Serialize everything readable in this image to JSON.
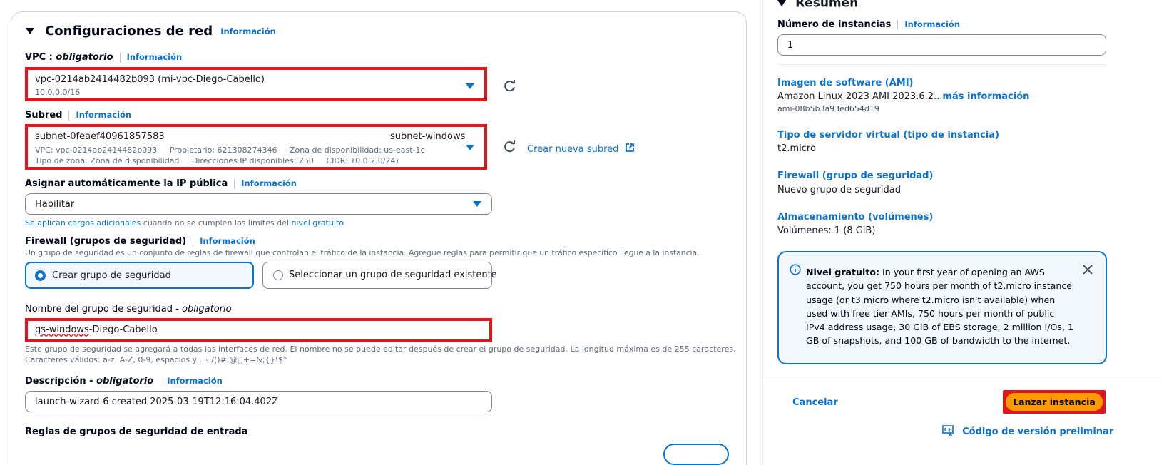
{
  "left": {
    "section_title": "Configuraciones de red",
    "section_info": "Información",
    "vpc": {
      "label": "VPC : ",
      "label_req": "obligatorio",
      "info": "Información",
      "value": "vpc-0214ab2414482b093 (mi-vpc-Diego-Cabello)",
      "cidr": "10.0.0.0/16"
    },
    "subnet": {
      "label": "Subred",
      "info": "Información",
      "id": "subnet-0feaef40961857583",
      "name": "subnet-windows",
      "line2": "VPC: vpc-0214ab2414482b093     Propietario: 621308274346     Zona de disponibilidad: us-east-1c",
      "line3": "Tipo de zona: Zona de disponibilidad     Direcciones IP disponibles: 250     CIDR: 10.0.2.0/24)",
      "create_link": "Crear nueva subred"
    },
    "public_ip": {
      "label": "Asignar automáticamente la IP pública",
      "info": "Información",
      "value": "Habilitar",
      "note_link": "Se aplican cargos adicionales",
      "note_mid": " cuando no se cumplen los límites del ",
      "note_link2": "nivel gratuito"
    },
    "firewall": {
      "label": "Firewall (grupos de seguridad)",
      "info": "Información",
      "desc": "Un grupo de seguridad es un conjunto de reglas de firewall que controlan el tráfico de la instancia. Agregue reglas para permitir que un tráfico específico llegue a la instancia.",
      "option_create": "Crear grupo de seguridad",
      "option_existing": "Seleccionar un grupo de seguridad existente"
    },
    "sg_name": {
      "label": "Nombre del grupo de seguridad - ",
      "label_req": "obligatorio",
      "value_underlined": "gs-windows",
      "value_rest": "-Diego-Cabello",
      "help1": "Este grupo de seguridad se agregará a todas las interfaces de red. El nombre no se puede editar después de crear el grupo de seguridad. La longitud máxima es de 255 caracteres.",
      "help2": "Caracteres válidos: a-z, A-Z, 0-9, espacios y ._-:/()#,@[]+=&;{}!$*"
    },
    "description": {
      "label": "Descripción - ",
      "label_req": "obligatorio",
      "info": "Información",
      "value": "launch-wizard-6 created 2025-03-19T12:16:04.402Z"
    },
    "inbound_rules_title": "Reglas de grupos de seguridad de entrada"
  },
  "right": {
    "summary_title": "Resumen",
    "instances_label": "Número de instancias",
    "instances_info": "Información",
    "instances_value": "1",
    "ami_title": "Imagen de software (AMI)",
    "ami_value": "Amazon Linux 2023 AMI 2023.6.2...",
    "ami_more": "más información",
    "ami_id": "ami-08b5b3a93ed654d19",
    "instance_type_title": "Tipo de servidor virtual (tipo de instancia)",
    "instance_type_value": "t2.micro",
    "firewall_title": "Firewall (grupo de seguridad)",
    "firewall_value": "Nuevo grupo de seguridad",
    "storage_title": "Almacenamiento (volúmenes)",
    "storage_value": "Volúmenes: 1 (8 GiB)",
    "free_tier_bold": "Nivel gratuito:",
    "free_tier_text": " In your first year of opening an AWS account, you get 750 hours per month of t2.micro instance usage (or t3.micro where t2.micro isn't available) when used with free tier AMIs, 750 hours per month of public IPv4 address usage, 30 GiB of EBS storage, 2 million I/Os, 1 GB of snapshots, and 100 GB of bandwidth to the internet.",
    "cancel": "Cancelar",
    "launch": "Lanzar instancia",
    "preview_code": "Código de versión preliminar"
  }
}
